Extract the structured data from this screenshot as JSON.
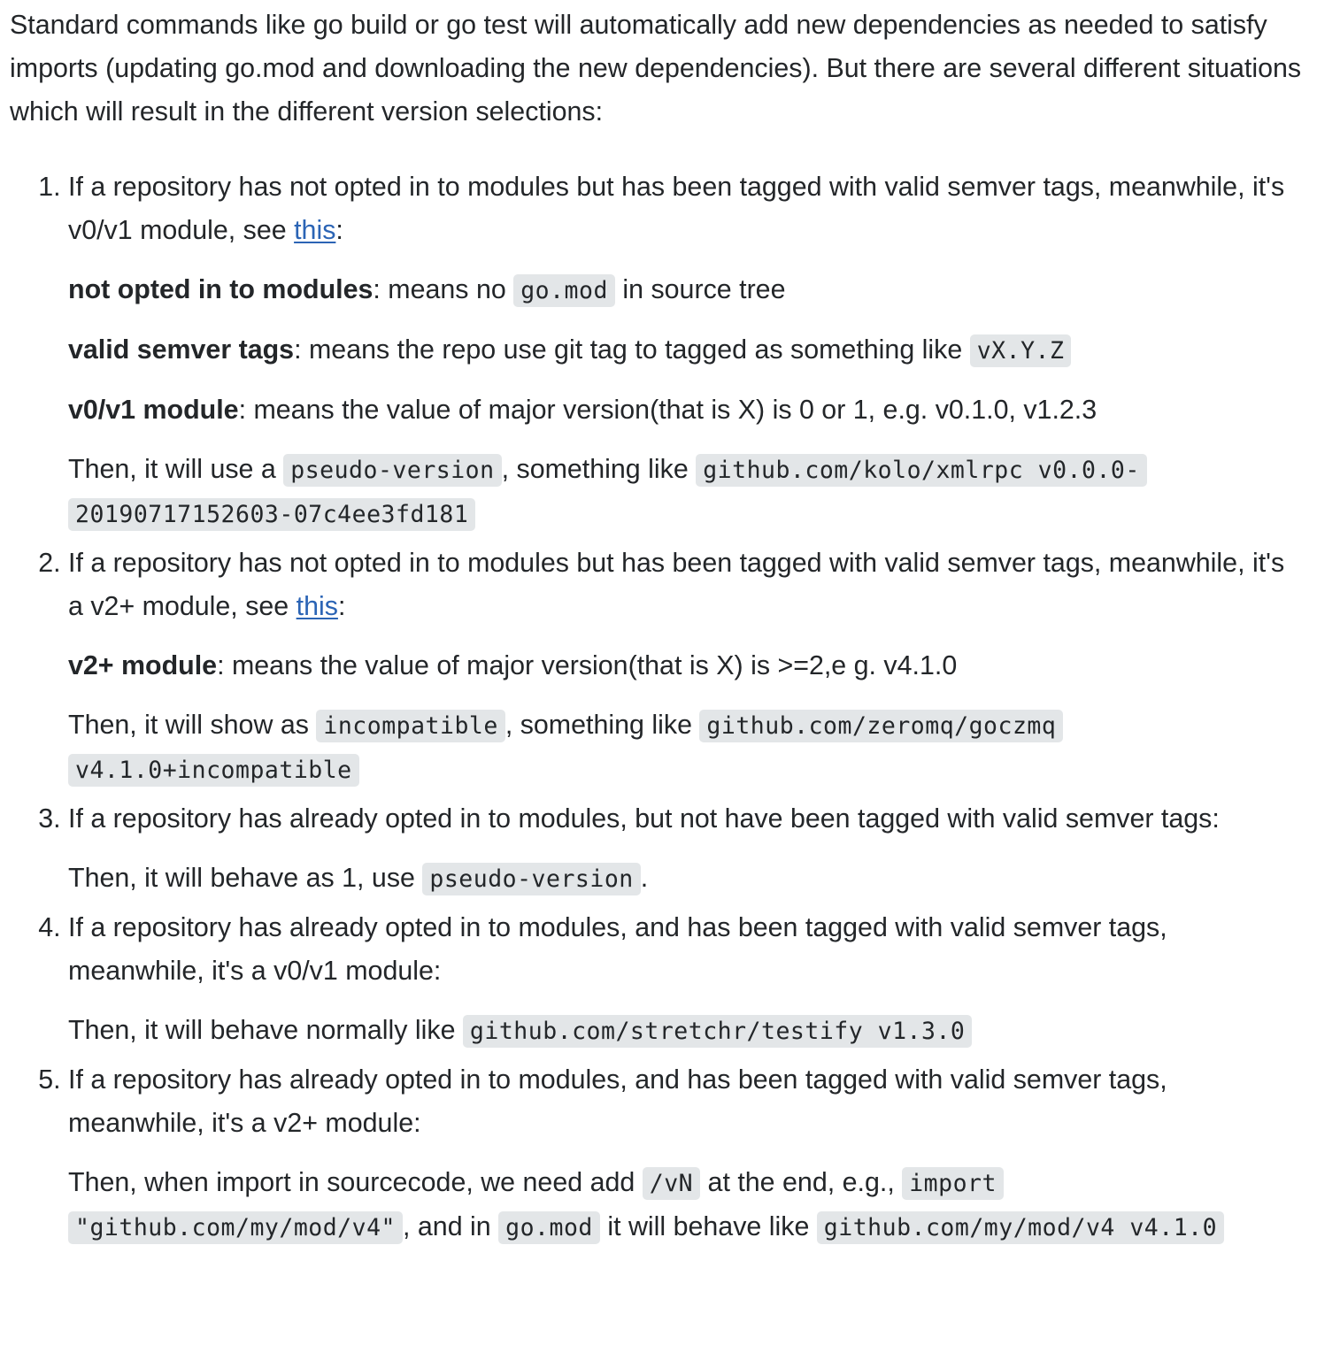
{
  "intro": "Standard commands like go build or go test will automatically add new dependencies as needed to satisfy imports (updating go.mod and downloading the new dependencies). But there are several different situations which will result in the different version selections:",
  "colors": {
    "text": "#232629",
    "link": "#2b64b5",
    "code_background": "#e3e6e8"
  },
  "items": [
    {
      "title_prefix": "If a repository has not opted in to modules but has been tagged with valid semver tags, meanwhile, it's v0/v1 module, see ",
      "link": "this",
      "title_suffix": ":",
      "def1": {
        "term": "not opted in to modules",
        "pre": ": means no ",
        "code": "go.mod",
        "post": " in source tree"
      },
      "def2": {
        "term": "valid semver tags",
        "pre": ": means the repo use git tag to tagged as something like ",
        "code": "vX.Y.Z"
      },
      "def3": {
        "term": "v0/v1 module",
        "text": ": means the value of major version(that is X) is 0 or 1, e.g. v0.1.0, v1.2.3"
      },
      "then": {
        "pre": "Then, it will use a ",
        "code1": "pseudo-version",
        "mid": ", something like ",
        "code2": "github.com/kolo/xmlrpc v0.0.0-20190717152603-07c4ee3fd181"
      }
    },
    {
      "title_prefix": "If a repository has not opted in to modules but has been tagged with valid semver tags, meanwhile, it's a v2+ module, see ",
      "link": "this",
      "title_suffix": ":",
      "def1": {
        "term": "v2+ module",
        "text": ": means the value of major version(that is X) is >=2,e g. v4.1.0"
      },
      "then": {
        "pre": "Then, it will show as ",
        "code1": "incompatible",
        "mid": ", something like ",
        "code2": "github.com/zeromq/goczmq v4.1.0+incompatible"
      }
    },
    {
      "title": "If a repository has already opted in to modules, but not have been tagged with valid semver tags:",
      "then": {
        "pre": "Then, it will behave as 1, use ",
        "code": "pseudo-version",
        "post": "."
      }
    },
    {
      "title": "If a repository has already opted in to modules, and has been tagged with valid semver tags, meanwhile, it's a v0/v1 module:",
      "then": {
        "pre": "Then, it will behave normally like ",
        "code": "github.com/stretchr/testify v1.3.0"
      }
    },
    {
      "title": "If a repository has already opted in to modules, and has been tagged with valid semver tags, meanwhile, it's a v2+ module:",
      "then": {
        "pre": "Then, when import in sourcecode, we need add ",
        "code1": "/vN",
        "mid1": " at the end, e.g., ",
        "code2": "import \"github.com/my/mod/v4\"",
        "mid2": ", and in ",
        "code3": "go.mod",
        "mid3": " it will behave like ",
        "code4": "github.com/my/mod/v4 v4.1.0"
      }
    }
  ]
}
